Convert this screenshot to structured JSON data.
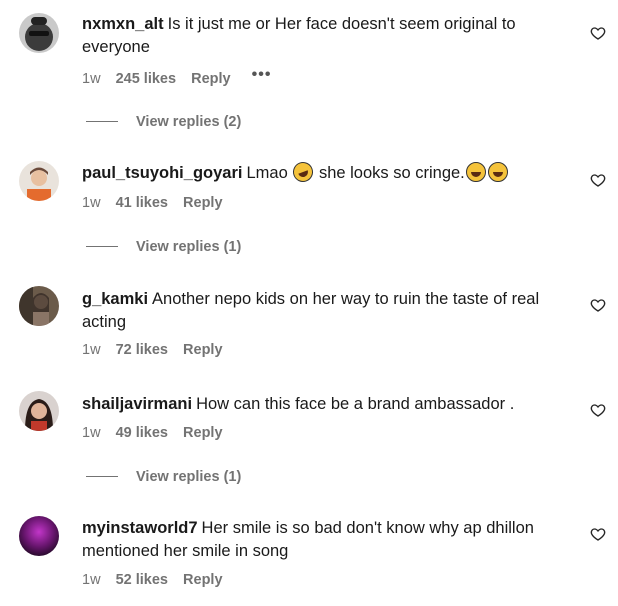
{
  "comments": [
    {
      "username": "nxmxn_alt",
      "text": "Is it just me or Her face doesn't seem original to everyone",
      "age": "1w",
      "likes": "245 likes",
      "reply_label": "Reply",
      "more": "•••",
      "view_replies": "View replies (2)"
    },
    {
      "username": "paul_tsuyohi_goyari",
      "text_a": "Lmao",
      "text_b": "she looks so cringe.",
      "age": "1w",
      "likes": "41 likes",
      "reply_label": "Reply",
      "view_replies": "View replies (1)"
    },
    {
      "username": "g_kamki",
      "text": "Another nepo kids on her way to ruin the taste of real acting",
      "age": "1w",
      "likes": "72 likes",
      "reply_label": "Reply"
    },
    {
      "username": "shailjavirmani",
      "text": "How can this face be a brand ambassador .",
      "age": "1w",
      "likes": "49 likes",
      "reply_label": "Reply",
      "view_replies": "View replies (1)"
    },
    {
      "username": "myinstaworld7",
      "text": "Her smile is so bad don't know why ap dhillon mentioned her smile in song",
      "age": "1w",
      "likes": "52 likes",
      "reply_label": "Reply"
    }
  ],
  "icons": {
    "like": "heart-outline-icon",
    "emoji_laugh": "rofl-emoji",
    "emoji_joy": "joy-emoji"
  }
}
